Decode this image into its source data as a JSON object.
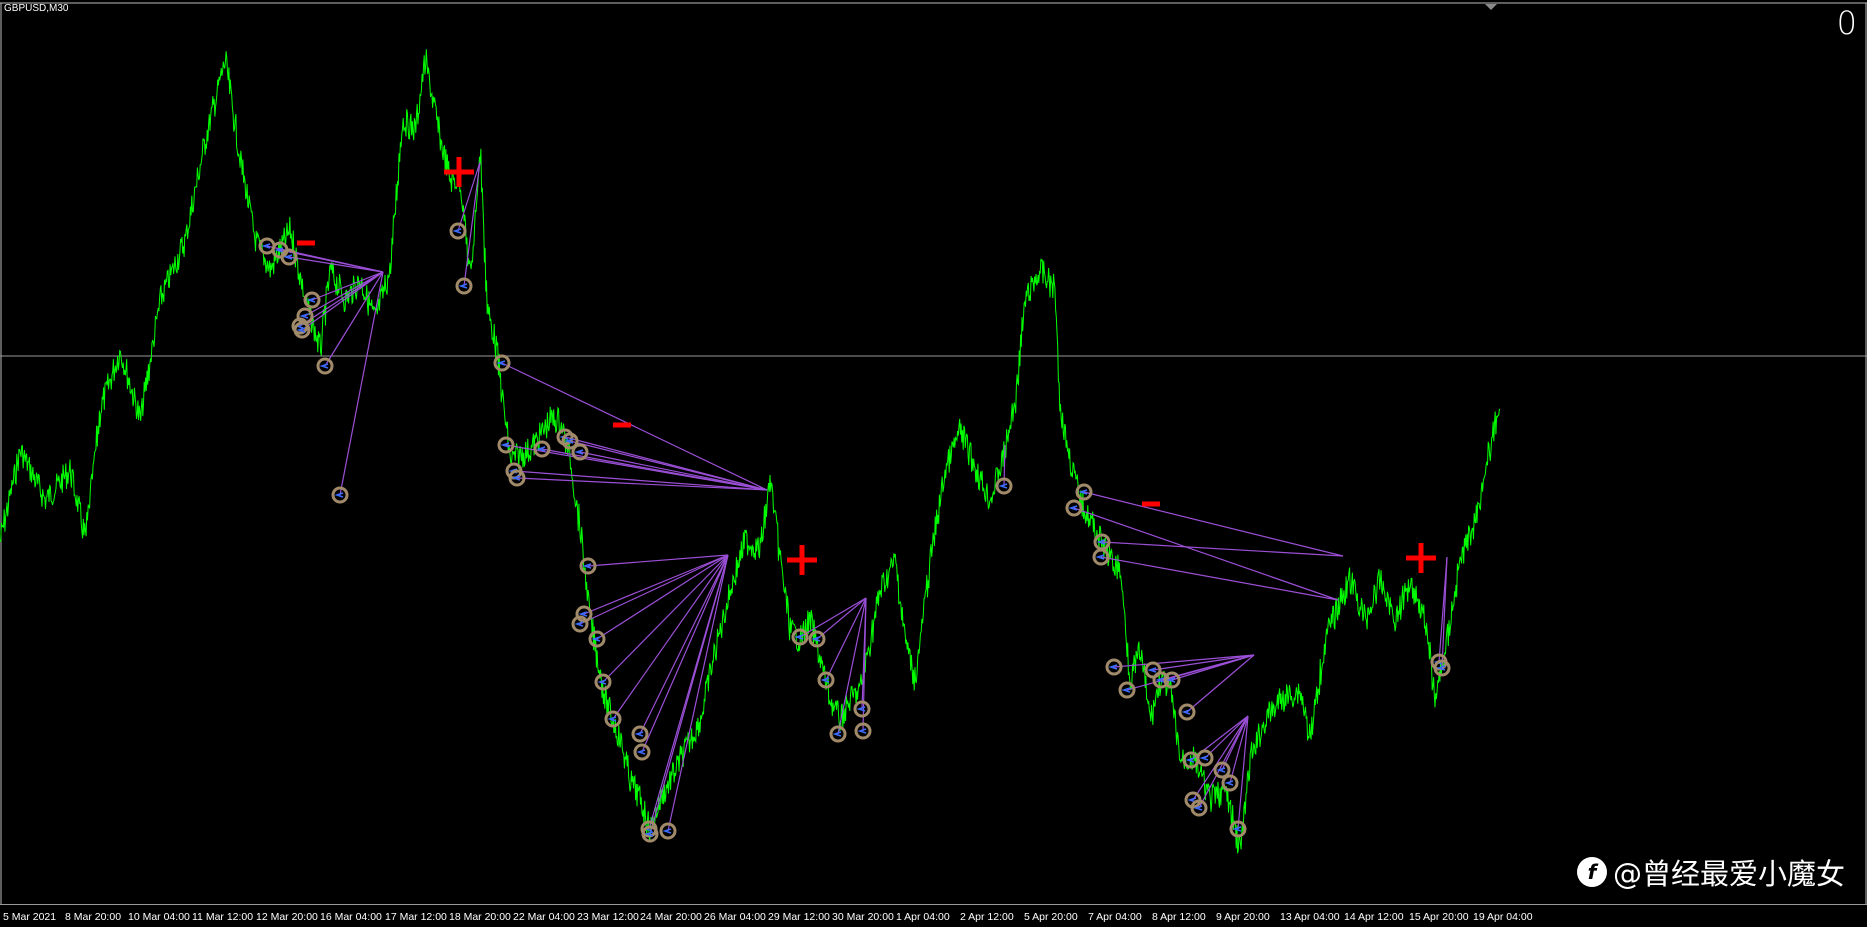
{
  "window": {
    "symbol_title": "GBPUSD,M30",
    "right_label": "0"
  },
  "colors": {
    "background": "#000000",
    "price": "#00ff00",
    "trade_lines": "#9b4fd6",
    "markers": "#a08a6a",
    "signals": "#ff0000",
    "grid": "#9a9a9a"
  },
  "signals": [
    "−",
    "+",
    "−",
    "+",
    "−",
    "+"
  ],
  "time_axis": {
    "labels": [
      "5 Mar 2021",
      "8 Mar 20:00",
      "10 Mar 04:00",
      "11 Mar 12:00",
      "12 Mar 20:00",
      "16 Mar 04:00",
      "17 Mar 12:00",
      "18 Mar 20:00",
      "22 Mar 04:00",
      "23 Mar 12:00",
      "24 Mar 20:00",
      "26 Mar 04:00",
      "29 Mar 12:00",
      "30 Mar 20:00",
      "1 Apr 04:00",
      "2 Apr 12:00",
      "5 Apr 20:00",
      "7 Apr 04:00",
      "8 Apr 12:00",
      "9 Apr 20:00",
      "13 Apr 04:00",
      "14 Apr 12:00",
      "15 Apr 20:00",
      "19 Apr 04:00"
    ]
  },
  "watermark": {
    "text": "@曾经最爱小魔女"
  }
}
